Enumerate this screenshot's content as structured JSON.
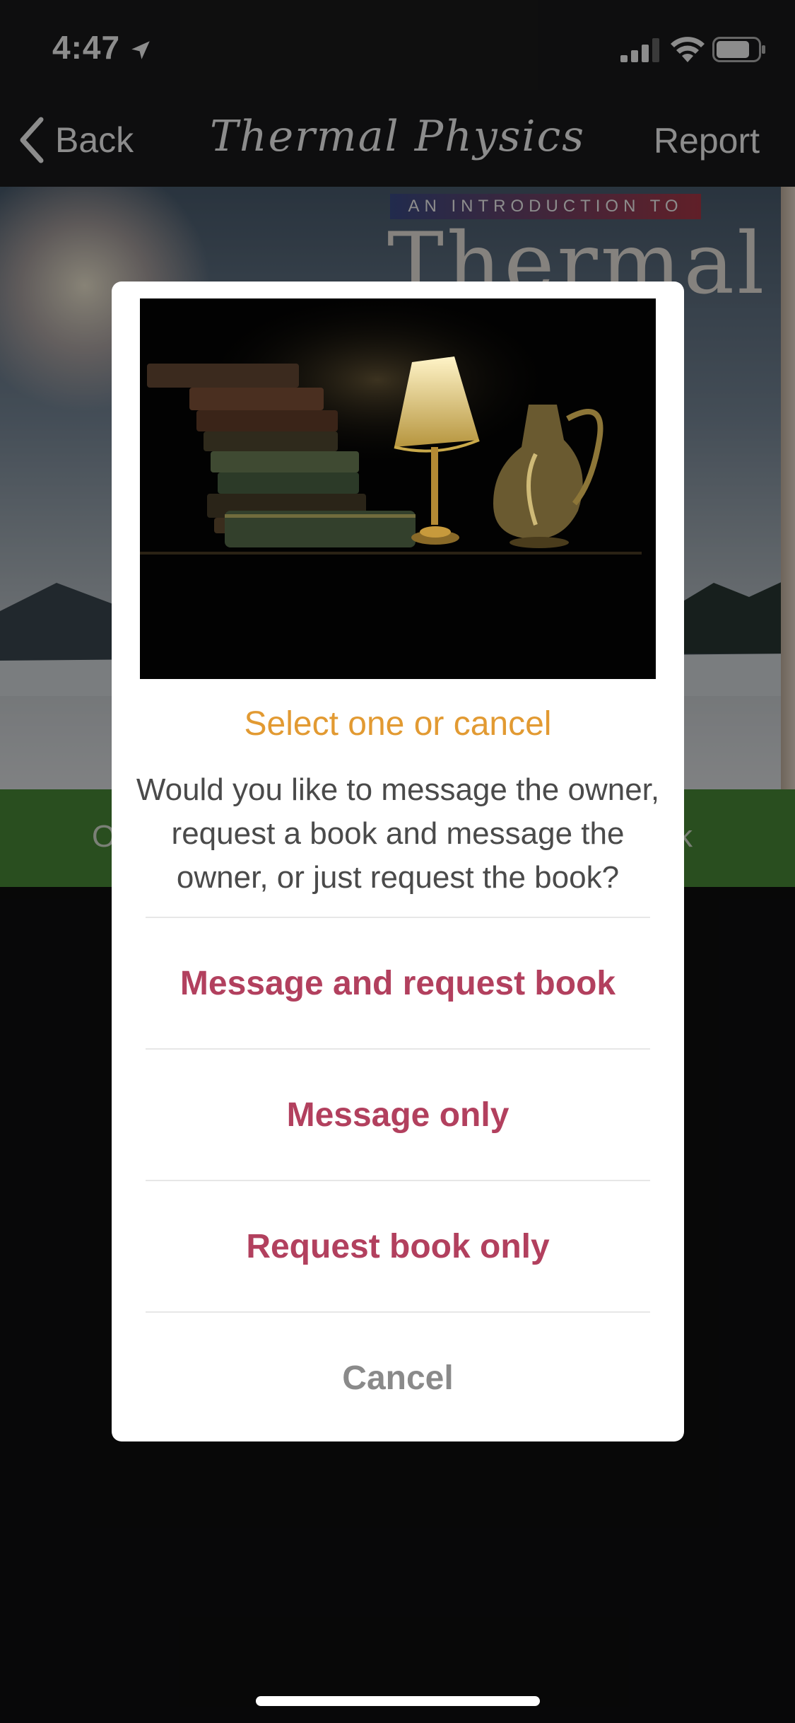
{
  "status_bar": {
    "time": "4:47",
    "icons": [
      "location-arrow-icon",
      "cellular-signal-icon",
      "wifi-icon",
      "battery-icon"
    ]
  },
  "nav": {
    "back_label": "Back",
    "title": "Thermal Physics",
    "report_label": "Report"
  },
  "background": {
    "cover_banner": "AN INTRODUCTION TO",
    "cover_title": "Thermal",
    "green_bar_left": "O",
    "green_bar_right": "k"
  },
  "dialog": {
    "title": "Select one or cancel",
    "message": "Would you like to message the owner, request a book and message the owner, or just request the book?",
    "actions": [
      {
        "label": "Message and request book"
      },
      {
        "label": "Message only"
      },
      {
        "label": "Request book only"
      },
      {
        "label": "Cancel"
      }
    ]
  },
  "colors": {
    "accent_title": "#e29a32",
    "action_text": "#b2405e",
    "cancel_text": "#8a8a8a",
    "green_bar": "#4b8e39",
    "nav_background": "#1b1b1c"
  }
}
